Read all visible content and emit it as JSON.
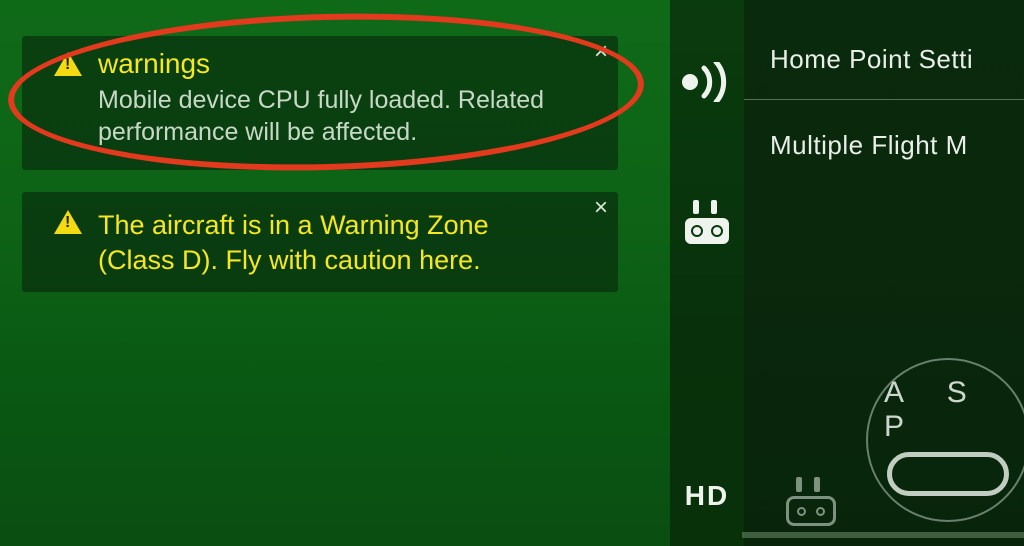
{
  "notifications": [
    {
      "title": "warnings",
      "body": "Mobile device CPU fully loaded. Related performance will be affected.",
      "close": "×"
    },
    {
      "body": "The aircraft is in a Warning Zone (Class D). Fly with caution here.",
      "close": "×"
    }
  ],
  "statusBar": {
    "hd": "HD"
  },
  "settings": {
    "row1": "Home Point Setti",
    "row2": "Multiple Flight M"
  },
  "modeWidget": {
    "letters": "A S P"
  },
  "annotation": {
    "circle_color": "#e33a1e"
  }
}
